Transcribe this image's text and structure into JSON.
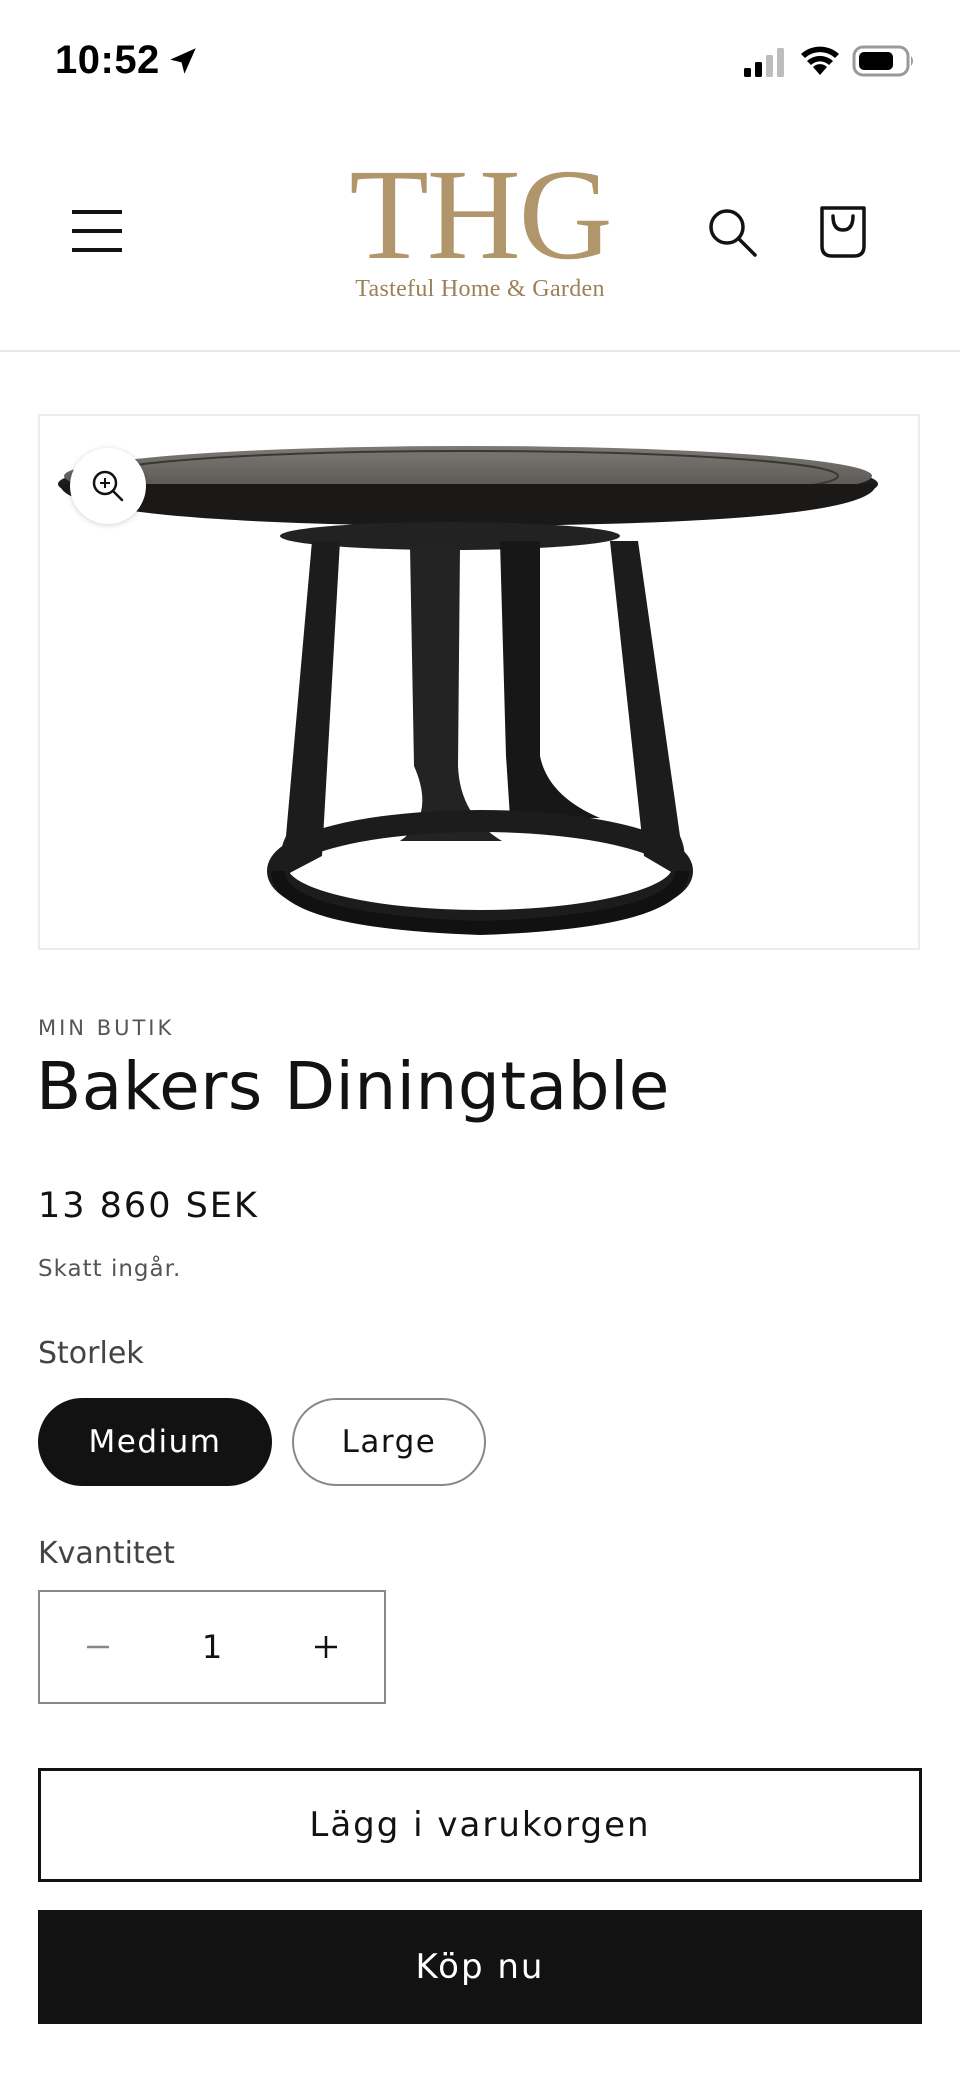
{
  "status_bar": {
    "time": "10:52",
    "icons": [
      "location-arrow-icon",
      "cellular-signal-icon",
      "wifi-icon",
      "battery-icon"
    ]
  },
  "header": {
    "logo_mark": "THG",
    "logo_tagline": "Tasteful Home & Garden",
    "icons": [
      "menu-icon",
      "search-icon",
      "cart-icon"
    ]
  },
  "product": {
    "vendor": "MIN BUTIK",
    "title": "Bakers Diningtable",
    "price": "13 860 SEK",
    "tax_note": "Skatt ingår."
  },
  "options": {
    "size_label": "Storlek",
    "sizes": [
      {
        "label": "Medium",
        "selected": true
      },
      {
        "label": "Large",
        "selected": false
      }
    ]
  },
  "quantity": {
    "label": "Kvantitet",
    "value": "1"
  },
  "actions": {
    "add_to_cart": "Lägg i varukorgen",
    "buy_now": "Köp nu"
  },
  "colors": {
    "brand_gold": "#b1956b",
    "primary": "#121212",
    "border": "#888888"
  }
}
